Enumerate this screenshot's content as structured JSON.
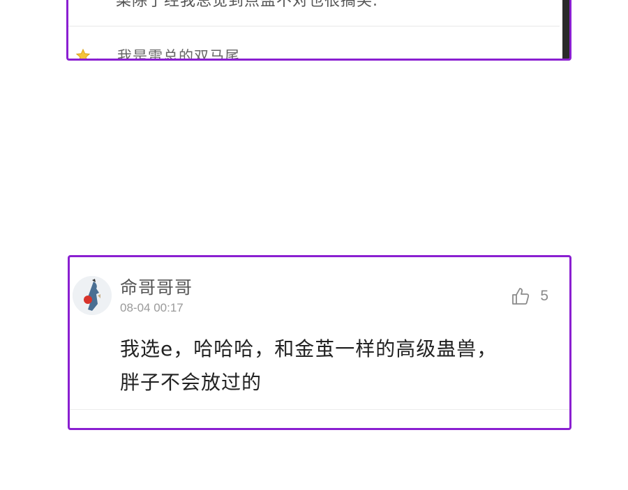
{
  "top_card": {
    "cut_off_text": "菜除了经我总觉到点盐不对也很搞笑.",
    "reply_author": "我是雷总的双马尾",
    "reply_separator": "、"
  },
  "comment": {
    "username": "命哥哥哥",
    "timestamp": "08-04 00:17",
    "like_count": "5",
    "body_line_1": "我选e，哈哈哈，和金茧一样的高级蛊兽，",
    "body_line_2": "胖子不会放过的"
  },
  "colors": {
    "highlight_border": "#8a1fd1",
    "text_primary": "#222222",
    "text_secondary": "#9a9a9a"
  },
  "icons": {
    "like": "thumbs-up-icon",
    "badge": "star-badge-icon",
    "avatar": "user-avatar"
  }
}
